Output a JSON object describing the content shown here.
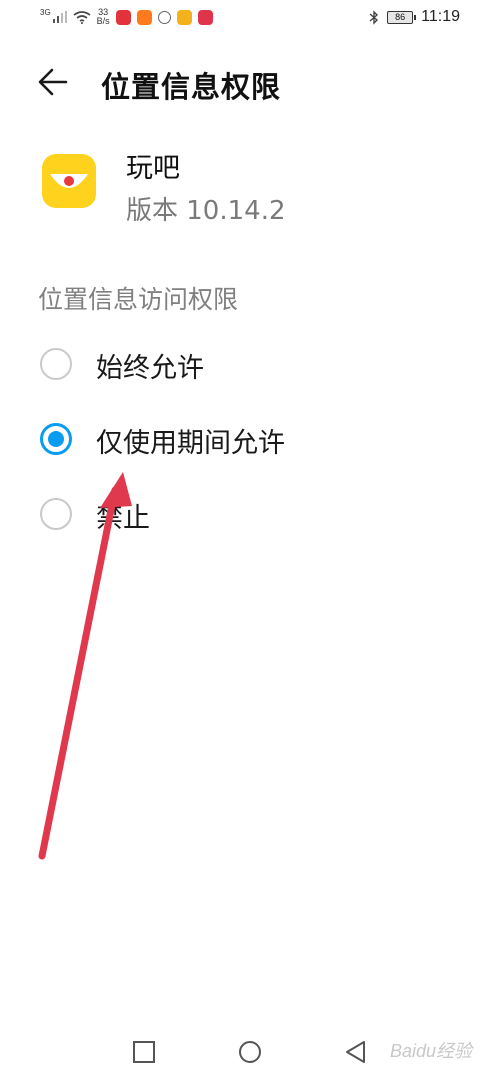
{
  "status_bar": {
    "signal_label": "3G",
    "net_speed_value": "33",
    "net_speed_unit": "B/s",
    "battery": "86",
    "time": "11:19"
  },
  "header": {
    "title": "位置信息权限"
  },
  "app": {
    "name": "玩吧",
    "version": "版本 10.14.2"
  },
  "permission": {
    "section_title": "位置信息访问权限",
    "options": [
      {
        "label": "始终允许",
        "selected": false
      },
      {
        "label": "仅使用期间允许",
        "selected": true
      },
      {
        "label": "禁止",
        "selected": false
      }
    ]
  },
  "watermark": "Baidu经验",
  "colors": {
    "accent": "#0a9cf0",
    "app_icon": "#ffd21e",
    "annotation_arrow": "#e0384c"
  }
}
